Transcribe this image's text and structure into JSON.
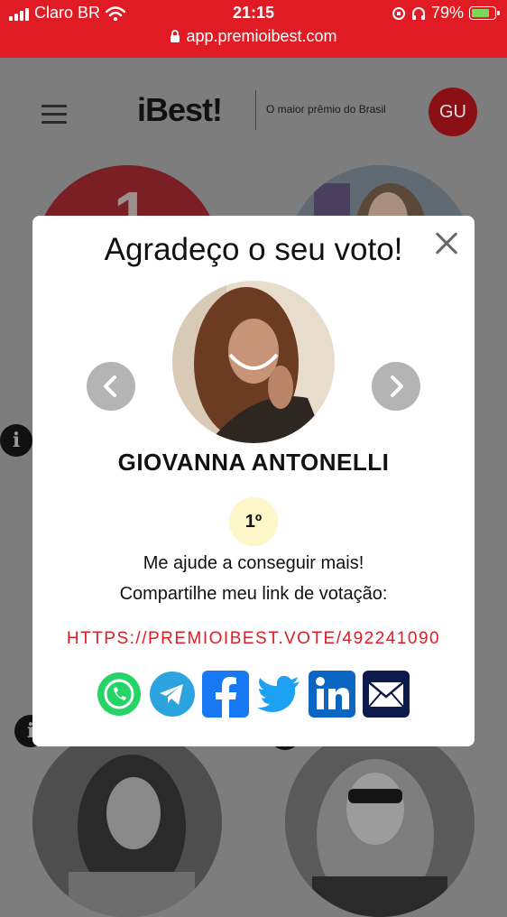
{
  "status_bar": {
    "carrier": "Claro BR",
    "time": "21:15",
    "battery": "79%",
    "battery_level": 0.79,
    "url": "app.premioibest.com"
  },
  "header": {
    "logo": "iBest!",
    "tagline": "O maior prêmio do Brasil",
    "avatar_initials": "GU"
  },
  "modal": {
    "title": "Agradeço o seu voto!",
    "name": "GIOVANNA ANTONELLI",
    "rank": "1º",
    "help_text": "Me ajude a conseguir mais!",
    "share_text": "Compartilhe meu link de votação:",
    "link": "HTTPS://PREMIOIBEST.VOTE/492241090",
    "share_buttons": [
      "whatsapp-icon",
      "telegram-icon",
      "facebook-icon",
      "twitter-icon",
      "linkedin-icon",
      "email-icon"
    ]
  },
  "background": {
    "rank_badge": "1",
    "info_glyph": "i"
  },
  "colors": {
    "brand_red": "#e01b24",
    "overlay": "#7d7d7d",
    "rank_bg": "#fdf6c8",
    "whatsapp": "#25d366",
    "telegram": "#2aa3df",
    "facebook": "#1877f2",
    "twitter": "#1da1f2",
    "linkedin": "#0a66c2",
    "email": "#0d1b4c"
  }
}
